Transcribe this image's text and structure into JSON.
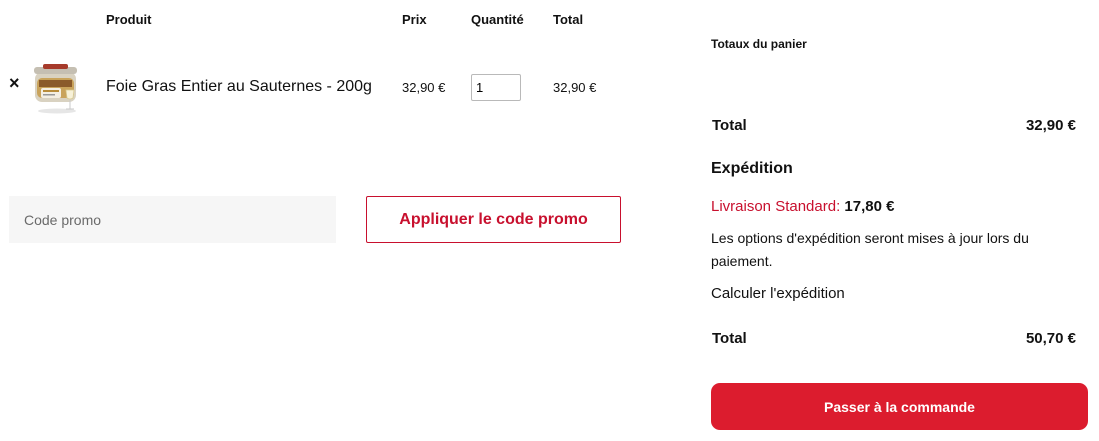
{
  "cart_table": {
    "headers": {
      "product": "Produit",
      "price": "Prix",
      "quantity": "Quantité",
      "total": "Total"
    },
    "items": [
      {
        "remove_icon": "close-icon",
        "remove_symbol": "×",
        "thumbnail": "foie-gras-jar-image",
        "name": "Foie Gras Entier au Sauternes - 200g",
        "price": "32,90 €",
        "quantity": "1",
        "total": "32,90 €"
      }
    ]
  },
  "coupon": {
    "placeholder": "Code promo",
    "apply_label": "Appliquer le code promo",
    "accent_color": "#c8102e"
  },
  "totals": {
    "title": "Totaux du panier",
    "subtotal_label": "Total",
    "subtotal_value": "32,90 €",
    "shipping_heading": "Expédition",
    "shipping_method": "Livraison Standard:",
    "shipping_amount": "17,80 €",
    "shipping_note": "Les options d'expédition seront mises à jour lors du paiement.",
    "calculate_shipping": "Calculer l'expédition",
    "total_label": "Total",
    "total_value": "50,70 €",
    "checkout_label": "Passer à la commande",
    "checkout_color": "#dc1c2e"
  }
}
